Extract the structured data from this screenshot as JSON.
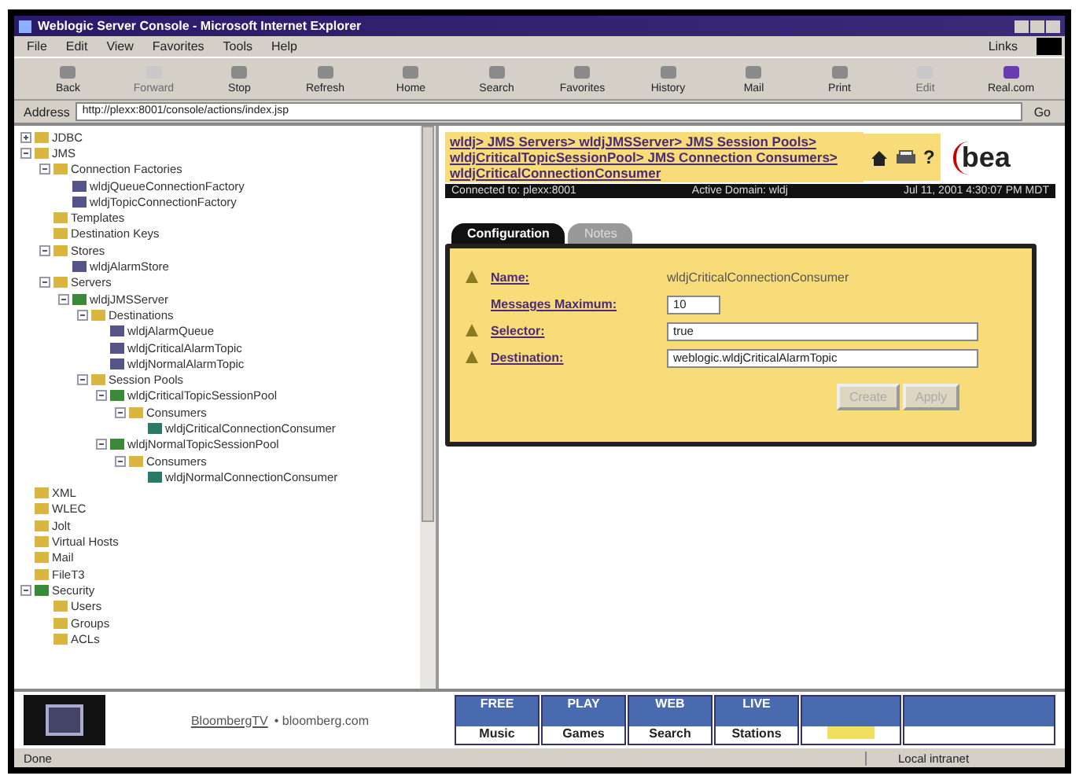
{
  "window": {
    "title": "Weblogic Server Console - Microsoft Internet Explorer"
  },
  "menu": [
    "File",
    "Edit",
    "View",
    "Favorites",
    "Tools",
    "Help"
  ],
  "links_label": "Links",
  "toolbar": [
    {
      "label": "Back",
      "disabled": false
    },
    {
      "label": "Forward",
      "disabled": true
    },
    {
      "label": "Stop",
      "disabled": false
    },
    {
      "label": "Refresh",
      "disabled": false
    },
    {
      "label": "Home",
      "disabled": false
    },
    {
      "label": "Search",
      "disabled": false
    },
    {
      "label": "Favorites",
      "disabled": false
    },
    {
      "label": "History",
      "disabled": false
    },
    {
      "label": "Mail",
      "disabled": false
    },
    {
      "label": "Print",
      "disabled": false
    },
    {
      "label": "Edit",
      "disabled": true
    },
    {
      "label": "Real.com",
      "disabled": false
    }
  ],
  "address": {
    "label": "Address",
    "value": "http://plexx:8001/console/actions/index.jsp",
    "go": "Go"
  },
  "tree": [
    {
      "label": "JDBC",
      "kind": "folder",
      "expanded": false
    },
    {
      "label": "JMS",
      "kind": "folder",
      "expanded": true,
      "children": [
        {
          "label": "Connection Factories",
          "kind": "folder",
          "expanded": true,
          "children": [
            {
              "label": "wldjQueueConnectionFactory",
              "kind": "leaf"
            },
            {
              "label": "wldjTopicConnectionFactory",
              "kind": "leaf"
            }
          ]
        },
        {
          "label": "Templates",
          "kind": "folder"
        },
        {
          "label": "Destination Keys",
          "kind": "folder"
        },
        {
          "label": "Stores",
          "kind": "folder",
          "expanded": true,
          "children": [
            {
              "label": "wldjAlarmStore",
              "kind": "leaf"
            }
          ]
        },
        {
          "label": "Servers",
          "kind": "folder",
          "expanded": true,
          "children": [
            {
              "label": "wldjJMSServer",
              "kind": "server",
              "expanded": true,
              "children": [
                {
                  "label": "Destinations",
                  "kind": "folder",
                  "expanded": true,
                  "children": [
                    {
                      "label": "wldjAlarmQueue",
                      "kind": "leaf"
                    },
                    {
                      "label": "wldjCriticalAlarmTopic",
                      "kind": "leaf"
                    },
                    {
                      "label": "wldjNormalAlarmTopic",
                      "kind": "leaf"
                    }
                  ]
                },
                {
                  "label": "Session Pools",
                  "kind": "folder",
                  "expanded": true,
                  "children": [
                    {
                      "label": "wldjCriticalTopicSessionPool",
                      "kind": "server",
                      "expanded": true,
                      "children": [
                        {
                          "label": "Consumers",
                          "kind": "folder",
                          "expanded": true,
                          "children": [
                            {
                              "label": "wldjCriticalConnectionConsumer",
                              "kind": "consumer"
                            }
                          ]
                        }
                      ]
                    },
                    {
                      "label": "wldjNormalTopicSessionPool",
                      "kind": "server",
                      "expanded": true,
                      "children": [
                        {
                          "label": "Consumers",
                          "kind": "folder",
                          "expanded": true,
                          "children": [
                            {
                              "label": "wldjNormalConnectionConsumer",
                              "kind": "consumer"
                            }
                          ]
                        }
                      ]
                    }
                  ]
                }
              ]
            }
          ]
        }
      ]
    },
    {
      "label": "XML",
      "kind": "folder"
    },
    {
      "label": "WLEC",
      "kind": "folder"
    },
    {
      "label": "Jolt",
      "kind": "folder"
    },
    {
      "label": "Virtual Hosts",
      "kind": "folder"
    },
    {
      "label": "Mail",
      "kind": "folder"
    },
    {
      "label": "FileT3",
      "kind": "folder"
    },
    {
      "label": "Security",
      "kind": "server",
      "expanded": true,
      "children": [
        {
          "label": "Users",
          "kind": "folder"
        },
        {
          "label": "Groups",
          "kind": "folder"
        },
        {
          "label": "ACLs",
          "kind": "folder"
        }
      ]
    }
  ],
  "breadcrumb": "wldj> JMS Servers> wldjJMSServer> JMS Session Pools> wldjCriticalTopicSessionPool> JMS Connection Consumers> wldjCriticalConnectionConsumer",
  "help_mark": "?",
  "logo": "bea",
  "info_bar": [
    "Connected to: plexx:8001",
    "Active Domain: wldj",
    "Jul 11, 2001 4:30:07 PM MDT"
  ],
  "tabs": [
    {
      "label": "Configuration",
      "selected": true
    },
    {
      "label": "Notes",
      "selected": false
    }
  ],
  "fields": [
    {
      "label": "Name:",
      "kind": "text",
      "value": "wldjCriticalConnectionConsumer",
      "warning": true
    },
    {
      "label": "Messages Maximum:",
      "kind": "short",
      "value": "10",
      "warning": false
    },
    {
      "label": "Selector:",
      "kind": "long",
      "value": "true",
      "warning": true
    },
    {
      "label": "Destination:",
      "kind": "long",
      "value": "weblogic.wldjCriticalAlarmTopic",
      "warning": true
    }
  ],
  "buttons": [
    "Create",
    "Apply"
  ],
  "banner": {
    "ad": "BloombergTV",
    "ad_url": "• bloomberg.com",
    "tiles": [
      {
        "top": "FREE",
        "bottom": "Music"
      },
      {
        "top": "PLAY",
        "bottom": "Games"
      },
      {
        "top": "WEB",
        "bottom": "Search"
      },
      {
        "top": "LIVE",
        "bottom": "Stations"
      }
    ]
  },
  "status_bar": {
    "text": "Done",
    "zone": "Local intranet"
  }
}
